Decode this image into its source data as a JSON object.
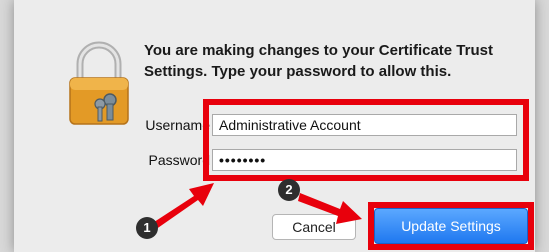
{
  "dialog": {
    "message": "You are making changes to your Certificate Trust Settings. Type your password to allow this.",
    "username_label": "Username",
    "username_value": "Administrative Account",
    "password_label": "Password",
    "password_value": "••••••••",
    "cancel_label": "Cancel",
    "update_label": "Update Settings"
  },
  "annotations": {
    "step1": "1",
    "step2": "2",
    "highlight_color": "#e8000c"
  },
  "icons": {
    "lock": "padlock-with-keys-icon"
  }
}
